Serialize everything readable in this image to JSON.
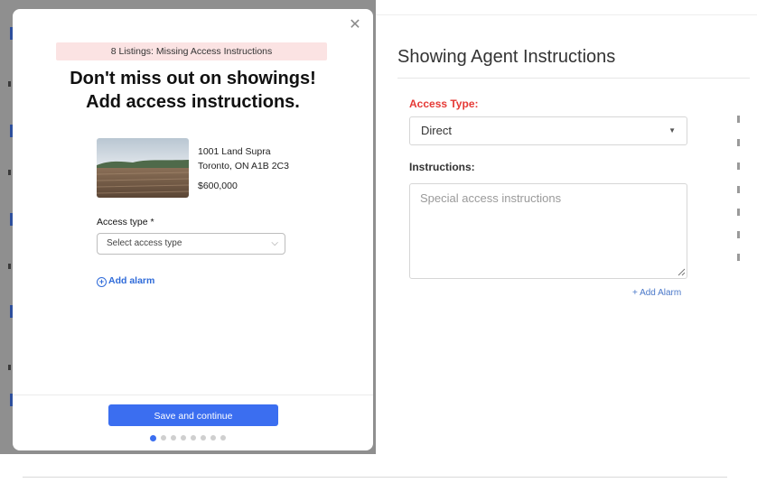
{
  "modal": {
    "banner": "8 Listings: Missing Access Instructions",
    "headline_line1": "Don't miss out on showings!",
    "headline_line2": "Add access instructions.",
    "listing": {
      "address_line1": "1001 Land Supra",
      "address_line2": "Toronto, ON A1B 2C3",
      "price": "$600,000"
    },
    "access_type_label": "Access type *",
    "access_type_placeholder": "Select access type",
    "add_alarm_label": "Add alarm",
    "save_button": "Save and continue",
    "pagination": {
      "total": 8,
      "current": 1
    }
  },
  "page": {
    "section_title": "Showing Agent Instructions",
    "access_type_label": "Access Type:",
    "access_type_value": "Direct",
    "instructions_label": "Instructions:",
    "instructions_placeholder": "Special access instructions",
    "add_alarm_label": "+ Add Alarm"
  },
  "colors": {
    "primary": "#3b6ef0",
    "alert_text": "#e53935",
    "banner_bg": "#fbe3e3",
    "link": "#2f6bd9"
  }
}
